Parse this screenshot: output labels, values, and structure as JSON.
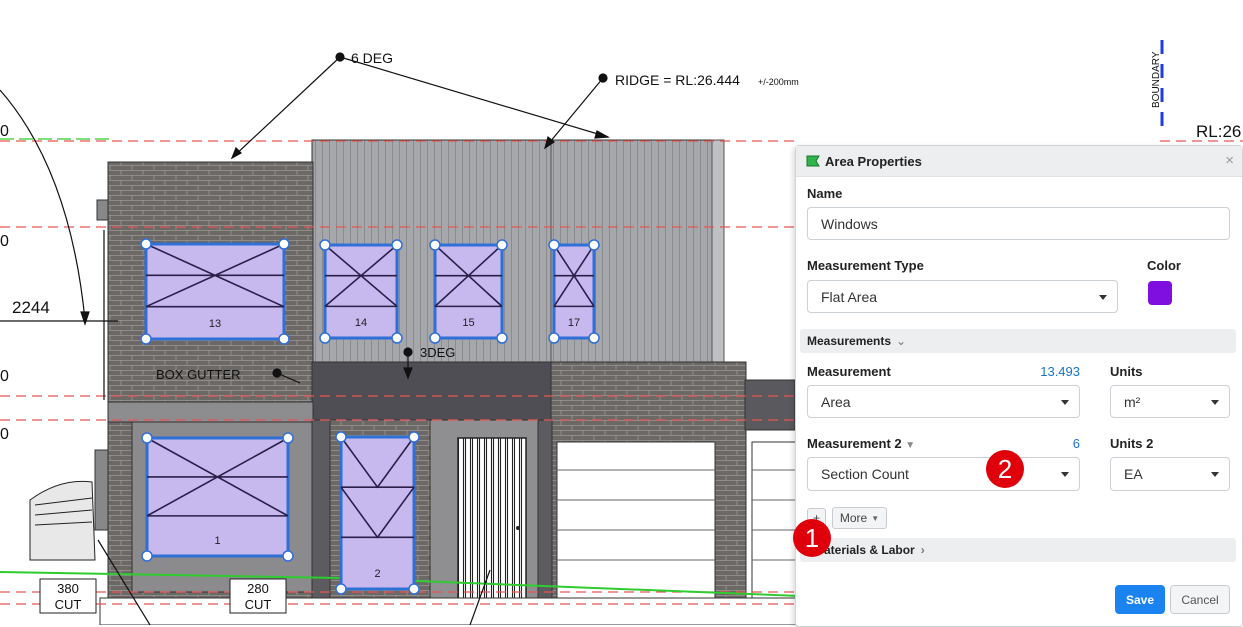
{
  "drawing": {
    "annotations": {
      "six_deg": "6 DEG",
      "ridge": "RIDGE = RL:26.444",
      "ridge_tol": "+/-200mm",
      "three_deg": "3DEG",
      "box_gutter": "BOX GUTTER",
      "dim_2244": "2244",
      "boundary": "BOUNDARY",
      "rl_edge": "RL:26",
      "left_zeros": [
        "0",
        "0",
        "0",
        "0"
      ],
      "cut_380_num": "380",
      "cut_380_label": "CUT",
      "cut_280_num": "280",
      "cut_280_label": "CUT"
    },
    "window_numbers": [
      "13",
      "14",
      "15",
      "17",
      "1",
      "2"
    ]
  },
  "panel": {
    "title": "Area Properties",
    "close_symbol": "×",
    "name_label": "Name",
    "name_value": "Windows",
    "measurement_type_label": "Measurement Type",
    "measurement_type_value": "Flat Area",
    "color_label": "Color",
    "color_value": "#7e0fe0",
    "measurements_section": "Measurements",
    "measurement_label": "Measurement",
    "measurement_number": "13.493",
    "measurement_value": "Area",
    "units_label": "Units",
    "units_value": "m²",
    "measurement2_label": "Measurement 2",
    "measurement2_number": "6",
    "measurement2_value": "Section Count",
    "units2_label": "Units 2",
    "units2_value": "EA",
    "add_symbol": "+",
    "more_label": "More",
    "materials_section": "aterials & Labor",
    "save_label": "Save",
    "cancel_label": "Cancel"
  },
  "badges": {
    "one": "1",
    "two": "2"
  },
  "colors": {
    "accent": "#1a73c8",
    "save_button": "#1a83f0",
    "window_fill": "#c7b9ee",
    "selection_blue": "#2f6fd6",
    "brick": "#6d6a68",
    "cladding": "#a9aaad",
    "dashed_red": "#e65555",
    "ground_green": "#2ecc2e",
    "badge_red": "#e0000b"
  }
}
